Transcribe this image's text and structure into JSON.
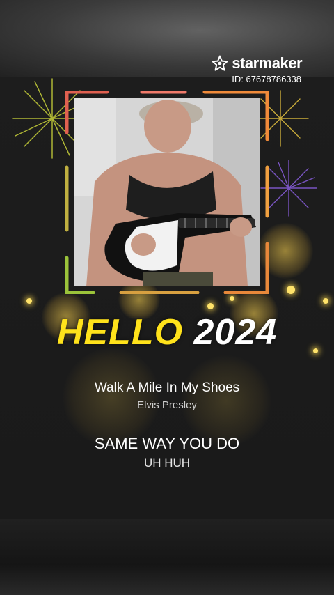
{
  "brand": {
    "name": "starmaker",
    "id_label": "ID: 67678786338",
    "icon": "starmaker-logo-icon"
  },
  "banner": {
    "word1": "HELLO",
    "word2": "2024"
  },
  "song": {
    "title": "Walk A Mile In My Shoes",
    "artist": "Elvis Presley"
  },
  "lyrics": {
    "current": "SAME WAY YOU DO",
    "next": "UH HUH"
  },
  "colors": {
    "accent_yellow": "#ffe21b",
    "frame_red": "#e05a4a",
    "frame_orange": "#f08a3a",
    "frame_green": "#9bc33a"
  }
}
